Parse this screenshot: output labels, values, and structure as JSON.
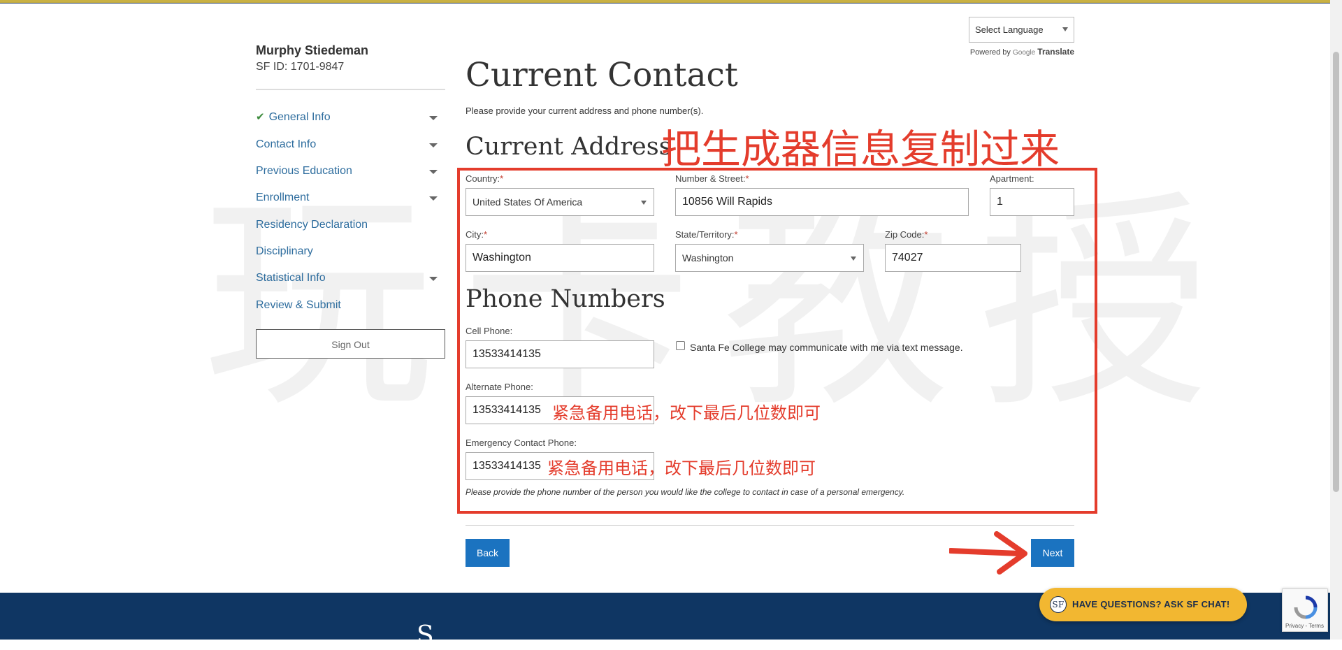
{
  "language": {
    "select_label": "Select Language",
    "powered_by": "Powered by",
    "google": "Google",
    "translate": "Translate"
  },
  "student": {
    "name": "Murphy Stiedeman",
    "id": "SF ID: 1701-9847"
  },
  "sidebar": {
    "items": [
      {
        "label": "General Info"
      },
      {
        "label": "Contact Info"
      },
      {
        "label": "Previous Education"
      },
      {
        "label": "Enrollment"
      },
      {
        "label": "Residency Declaration"
      },
      {
        "label": "Disciplinary"
      },
      {
        "label": "Statistical Info"
      },
      {
        "label": "Review & Submit"
      }
    ],
    "sign_out": "Sign Out"
  },
  "main": {
    "title": "Current Contact",
    "description": "Please provide your current address and phone number(s).",
    "address_title": "Current Address",
    "phone_title": "Phone Numbers"
  },
  "address": {
    "country_label": "Country:",
    "country_value": "United States Of America",
    "street_label": "Number & Street:",
    "street_value": "10856 Will Rapids",
    "apartment_label": "Apartment:",
    "apartment_value": "1",
    "city_label": "City:",
    "city_value": "Washington",
    "state_label": "State/Territory:",
    "state_value": "Washington",
    "zip_label": "Zip Code:",
    "zip_value": "74027",
    "required_mark": "*"
  },
  "phones": {
    "cell_label": "Cell Phone:",
    "cell_value": "13533414135",
    "text_consent": "Santa Fe College may communicate with me via text message.",
    "alternate_label": "Alternate Phone:",
    "alternate_value": "13533414135",
    "emergency_label": "Emergency Contact Phone:",
    "emergency_value": "13533414135",
    "emergency_help": "Please provide the phone number of the person you would like the college to contact in case of a personal emergency."
  },
  "annotations": {
    "copy_generator": "把生成器信息复制过来",
    "alternate_note": "紧急备用电话，改下最后几位数即可",
    "emergency_note": "紧急备用电话，改下最后几位数即可",
    "watermark": "玩卡教授"
  },
  "buttons": {
    "back": "Back",
    "next": "Next"
  },
  "footer": {
    "logo_letter": "S"
  },
  "chat": {
    "logo": "SF",
    "label": "HAVE QUESTIONS? ASK SF CHAT!"
  },
  "recaptcha": {
    "links": "Privacy - Terms"
  },
  "colors": {
    "link_blue": "#2e6d9e",
    "button_blue": "#1b73c0",
    "annotation_red": "#e43c2c",
    "footer_navy": "#0f3663",
    "chat_gold": "#f2b731"
  }
}
